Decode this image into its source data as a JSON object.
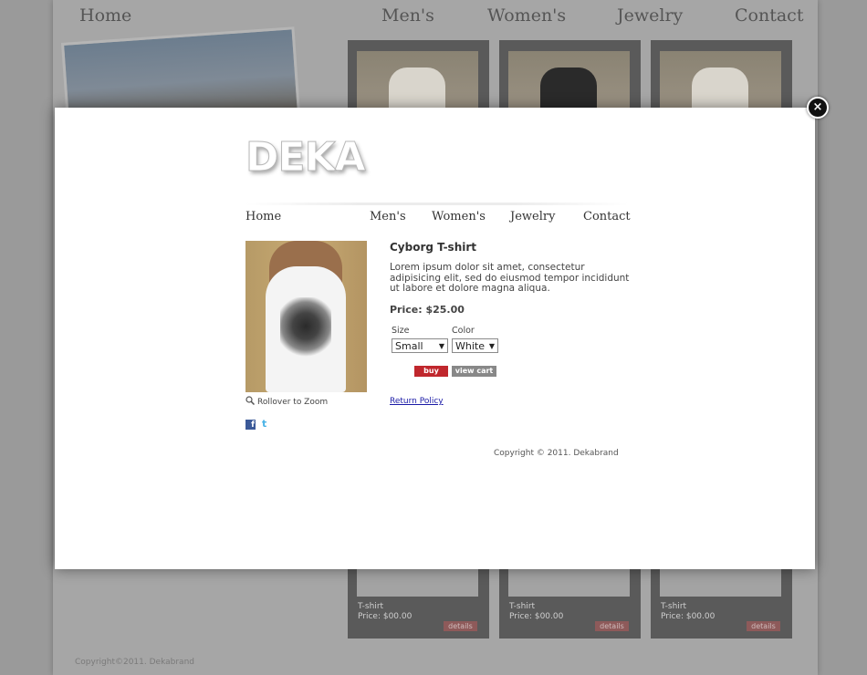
{
  "background": {
    "nav": [
      "Home",
      "Men's",
      "Women's",
      "Jewelry",
      "Contact"
    ],
    "cards": [
      {
        "title": "T-shirt",
        "price": "Price: $00.00",
        "button": "details"
      },
      {
        "title": "T-shirt",
        "price": "Price: $00.00",
        "button": "details"
      },
      {
        "title": "T-shirt",
        "price": "Price: $00.00",
        "button": "details"
      }
    ],
    "footer": "Copyright©2011. Dekabrand"
  },
  "modal": {
    "close_glyph": "×",
    "logo": "DEKA",
    "nav": [
      "Home",
      "Men's",
      "Women's",
      "Jewelry",
      "Contact"
    ],
    "zoom_hint": "Rollover to Zoom",
    "product": {
      "title": "Cyborg T-shirt",
      "description": "Lorem ipsum dolor sit amet, consectetur adipisicing elit, sed do eiusmod tempor incididunt ut labore et dolore magna aliqua.",
      "price": "Price: $25.00",
      "size_label": "Size",
      "size_value": "Small",
      "color_label": "Color",
      "color_value": "White"
    },
    "buy_label": "buy",
    "view_cart_label": "view cart",
    "return_policy": "Return Policy",
    "copyright": "Copyright © 2011. Dekabrand",
    "social": {
      "facebook_glyph": "f",
      "twitter_glyph": "t"
    }
  },
  "colors": {
    "buy_button": "#c0272d",
    "view_cart_button": "#888888",
    "link": "#1a1aa6",
    "facebook": "#3b5998",
    "twitter": "#4ab3e6"
  }
}
